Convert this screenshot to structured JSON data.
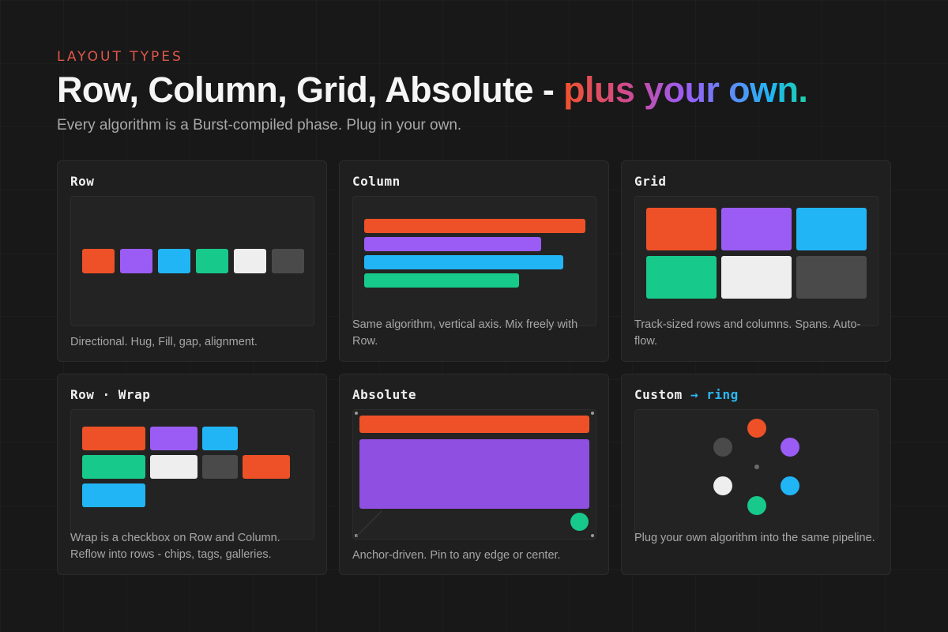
{
  "header": {
    "eyebrow": "LAYOUT TYPES",
    "headline_main": "Row, Column, Grid, Absolute - ",
    "headline_accent": "plus your own.",
    "subtitle": "Every algorithm is a Burst-compiled phase. Plug in your own."
  },
  "colors": {
    "orange": "#ee5127",
    "purple": "#9b5cf6",
    "blue": "#22b5f5",
    "green": "#17c98a",
    "white": "#eeeeee",
    "gray": "#4a4a4a",
    "eyebrow": "#e0574a",
    "ring_accent": "#2bb8f5"
  },
  "cards": {
    "row": {
      "title": "Row",
      "description": "Directional. Hug, Fill, gap, alignment."
    },
    "column": {
      "title": "Column",
      "description": "Same algorithm, vertical axis. Mix freely with Row."
    },
    "grid": {
      "title": "Grid",
      "description": "Track-sized rows and columns. Spans. Auto-flow."
    },
    "wrap": {
      "title": "Row · Wrap",
      "description": "Wrap is a checkbox on Row and Column. Reflow into rows - chips, tags, galleries."
    },
    "absolute": {
      "title": "Absolute",
      "description": "Anchor-driven. Pin to any edge or center."
    },
    "custom": {
      "title_main": "Custom ",
      "title_accent": "→ ring",
      "description": "Plug your own algorithm into the same pipeline."
    }
  }
}
